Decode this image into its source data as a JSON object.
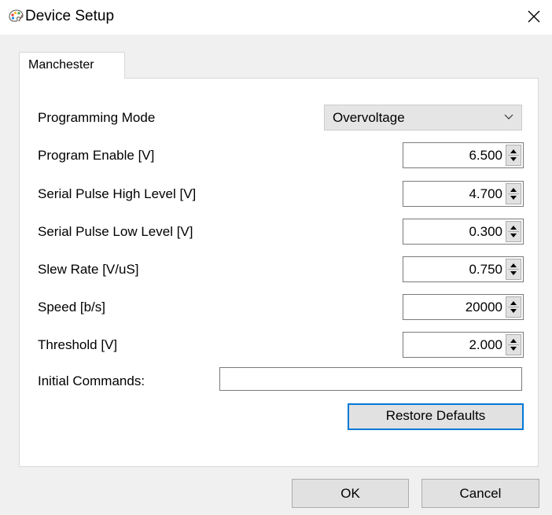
{
  "window": {
    "title": "Device Setup",
    "icon": "palette-app-icon",
    "close_icon": "close-icon"
  },
  "tabs": [
    {
      "label": "Manchester",
      "active": true
    }
  ],
  "settings": {
    "programming_mode": {
      "label": "Programming Mode",
      "value": "Overvoltage",
      "icon": "chevron-down-icon"
    },
    "program_enable": {
      "label": "Program Enable [V]",
      "value": "6.500"
    },
    "serial_pulse_high": {
      "label": "Serial Pulse High Level [V]",
      "value": "4.700"
    },
    "serial_pulse_low": {
      "label": "Serial Pulse Low Level [V]",
      "value": "0.300"
    },
    "slew_rate": {
      "label": "Slew Rate [V/uS]",
      "value": "0.750"
    },
    "speed": {
      "label": "Speed [b/s]",
      "value": "20000"
    },
    "threshold": {
      "label": "Threshold [V]",
      "value": "2.000"
    },
    "initial_commands": {
      "label": "Initial Commands:",
      "value": ""
    }
  },
  "buttons": {
    "restore_defaults": "Restore Defaults",
    "ok": "OK",
    "cancel": "Cancel"
  },
  "colors": {
    "accent": "#0078d7",
    "dialog_background": "#f0f0f0",
    "panel_background": "#ffffff"
  }
}
